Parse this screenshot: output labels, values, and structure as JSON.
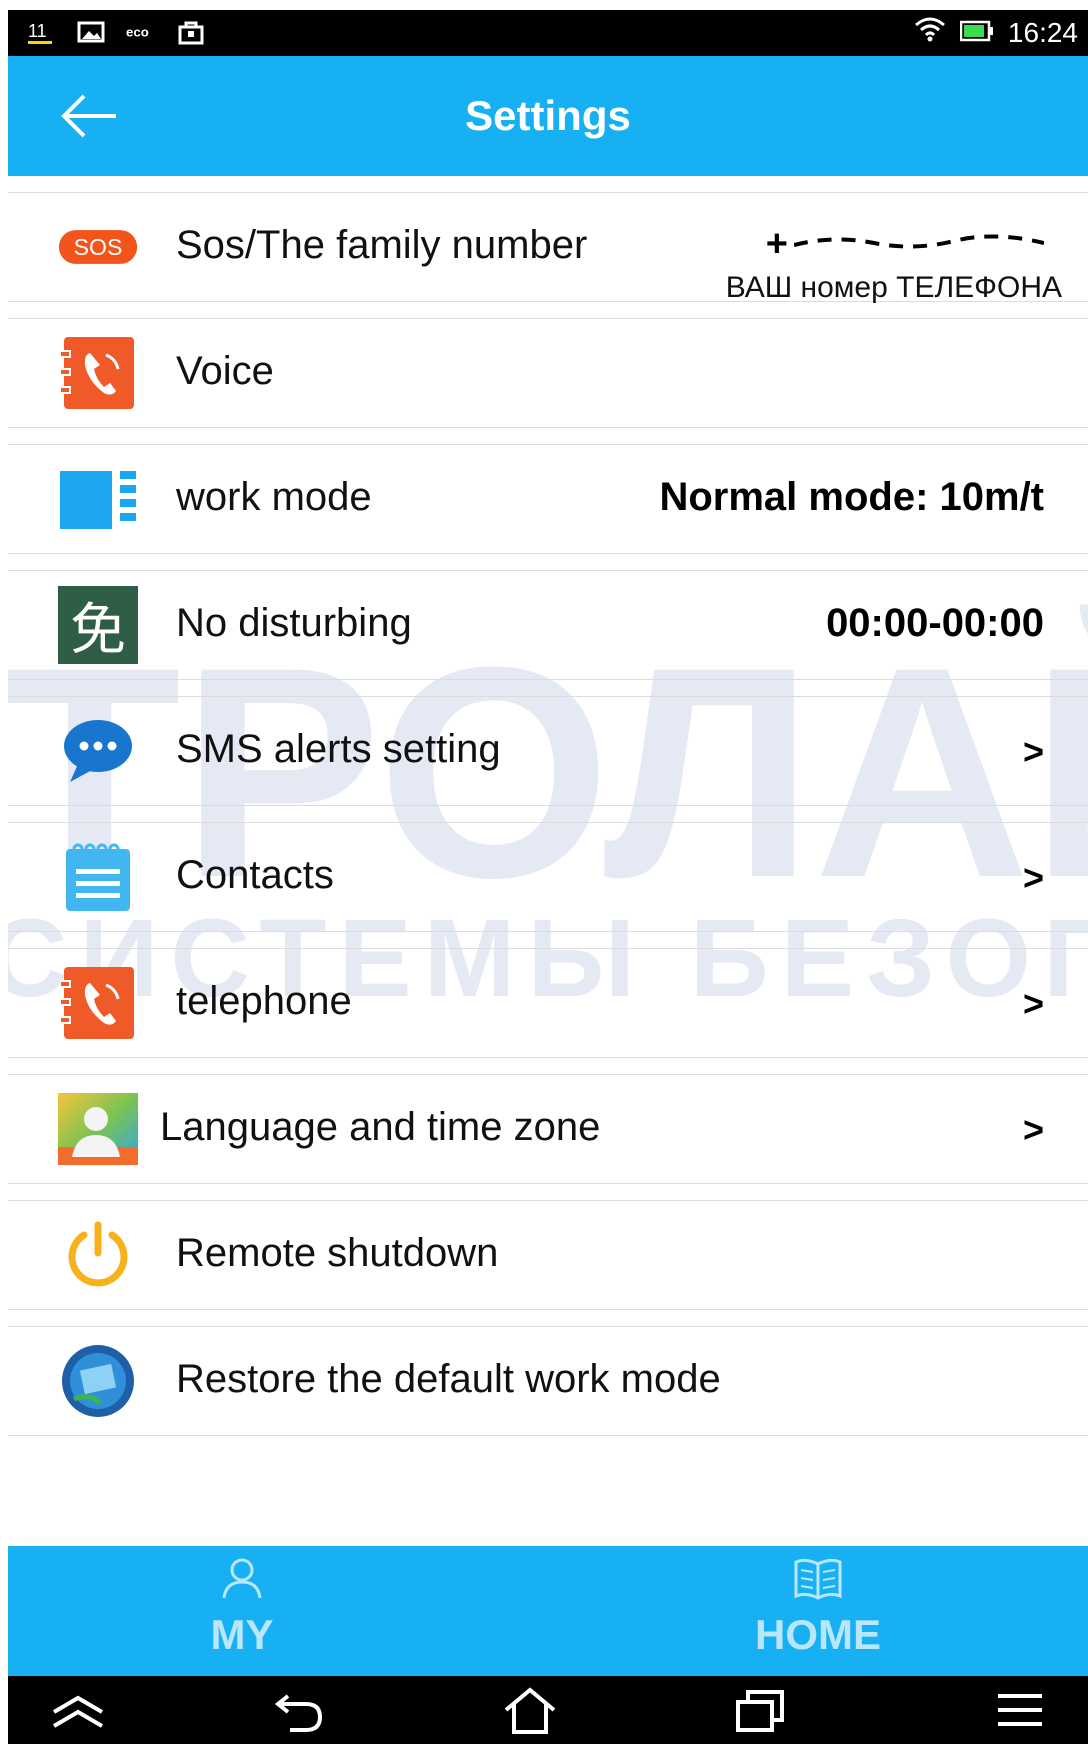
{
  "status_bar": {
    "time": "16:24",
    "icons": [
      "sim-icon",
      "image-icon",
      "eco-icon",
      "bag-icon",
      "wifi-icon",
      "battery-icon"
    ]
  },
  "app_bar": {
    "title": "Settings",
    "back_icon": "back-arrow-icon"
  },
  "watermark": {
    "line1": "ТРОЛАЙ",
    "line2": "СИСТЕМЫ БЕЗОПАСНОСТИ"
  },
  "settings": {
    "sos": {
      "label": "Sos/The family number",
      "badge": "SOS",
      "phone": "+",
      "note": "ВАШ номер ТЕЛЕФОНА"
    },
    "voice": {
      "label": "Voice"
    },
    "work_mode": {
      "label": "work mode",
      "value": "Normal mode: 10m/t"
    },
    "no_disturbing": {
      "label": "No disturbing",
      "value": "00:00-00:00",
      "icon_char": "免"
    },
    "sms_alerts": {
      "label": "SMS alerts setting",
      "chevron": ">"
    },
    "contacts": {
      "label": "Contacts",
      "chevron": ">"
    },
    "telephone": {
      "label": "telephone",
      "chevron": ">"
    },
    "language": {
      "label": "Language and time zone",
      "chevron": ">"
    },
    "shutdown": {
      "label": "Remote shutdown"
    },
    "restore": {
      "label": "Restore the default work mode"
    }
  },
  "bottom_nav": {
    "my": {
      "label": "MY",
      "icon": "person-icon"
    },
    "home": {
      "label": "HOME",
      "icon": "book-icon"
    }
  },
  "colors": {
    "accent": "#17b1f3",
    "sos_orange": "#f2541b",
    "phone_orange": "#ef5a28",
    "workmode_blue": "#1ba6ef",
    "disturb_green": "#2e5e45",
    "power_yellow": "#f7b21b"
  }
}
